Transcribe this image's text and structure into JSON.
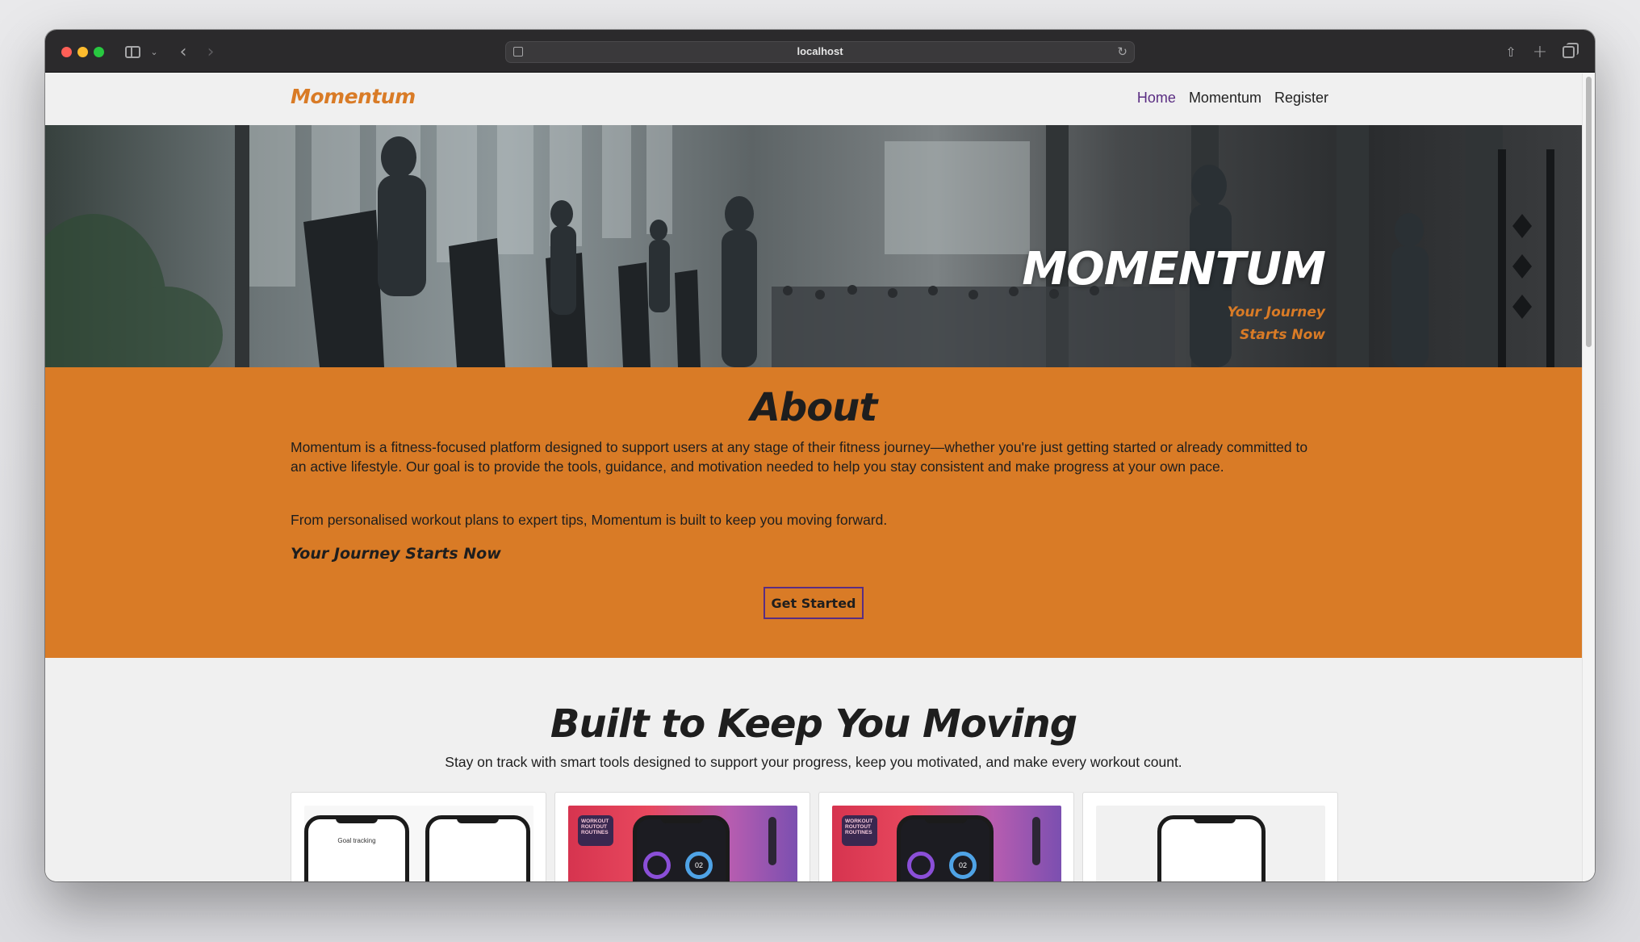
{
  "browser": {
    "url": "localhost"
  },
  "nav": {
    "brand": "Momentum",
    "links": [
      {
        "label": "Home",
        "active": true
      },
      {
        "label": "Momentum",
        "active": false
      },
      {
        "label": "Register",
        "active": false
      }
    ]
  },
  "hero": {
    "title": "MOMENTUM",
    "tagline_line1": "Your Journey",
    "tagline_line2": "Starts Now"
  },
  "about": {
    "title": "About",
    "paragraph1": "Momentum is a fitness-focused platform designed to support users at any stage of their fitness journey—whether you're just getting started or already committed to an active lifestyle. Our goal is to provide the tools, guidance, and motivation needed to help you stay consistent and make progress at your own pace.",
    "paragraph2": "From personalised workout plans to expert tips, Momentum is built to keep you moving forward.",
    "tagline": "Your Journey Starts Now",
    "cta_label": "Get Started"
  },
  "features": {
    "title": "Built to Keep You Moving",
    "subtitle": "Stay on track with smart tools designed to support your progress, keep you motivated, and make every workout count.",
    "cards": [
      {
        "screen_label": "Goal tracking"
      },
      {
        "badge": "WORKOUT ROUTOUT ROUTINES",
        "dial_value": "02"
      },
      {
        "badge": "WORKOUT ROUTOUT ROUTINES",
        "dial_value": "02"
      },
      {}
    ]
  },
  "colors": {
    "accent": "#d97b26",
    "nav_active": "#5a2d82",
    "page_bg": "#f0f0f0"
  }
}
